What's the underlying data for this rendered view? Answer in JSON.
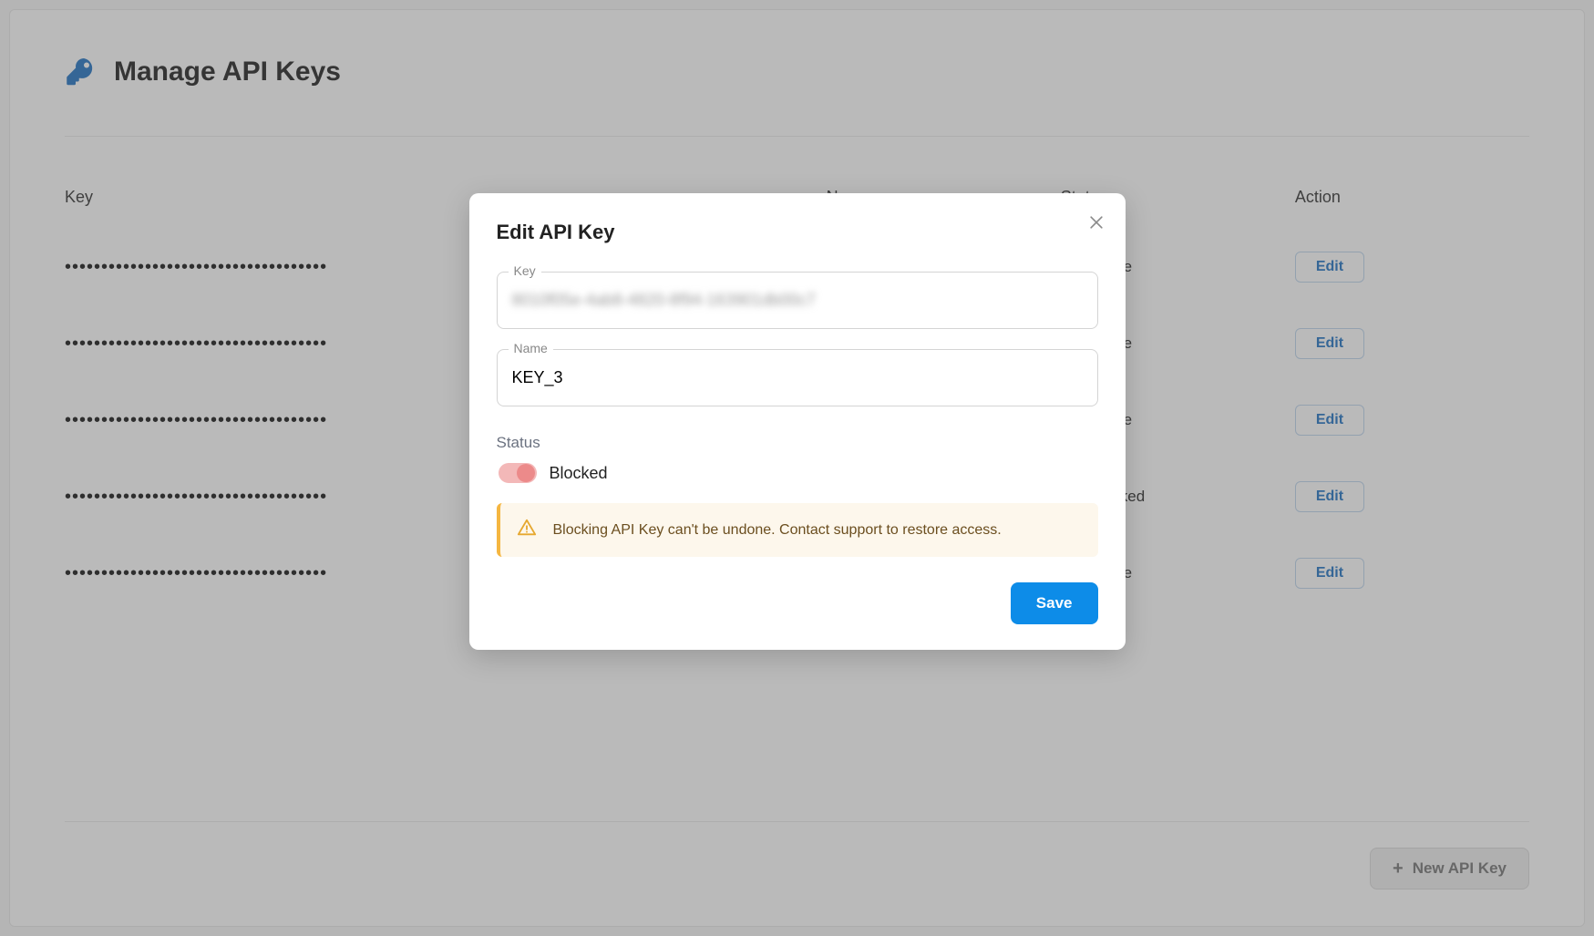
{
  "page": {
    "title": "Manage API Keys"
  },
  "table": {
    "columns": {
      "key": "Key",
      "name": "Name",
      "status": "Status",
      "action": "Action"
    },
    "rows": [
      {
        "masked": "••••••••••••••••••••••••••••••••••••",
        "name": "",
        "status": "Active",
        "status_kind": "active",
        "action": "Edit"
      },
      {
        "masked": "••••••••••••••••••••••••••••••••••••",
        "name": "",
        "status": "Active",
        "status_kind": "active",
        "action": "Edit"
      },
      {
        "masked": "••••••••••••••••••••••••••••••••••••",
        "name": "",
        "status": "Active",
        "status_kind": "active",
        "action": "Edit"
      },
      {
        "masked": "••••••••••••••••••••••••••••••••••••",
        "name": "",
        "status": "Blocked",
        "status_kind": "blocked",
        "action": "Edit"
      },
      {
        "masked": "••••••••••••••••••••••••••••••••••••",
        "name": "",
        "status": "Active",
        "status_kind": "active",
        "action": "Edit"
      }
    ]
  },
  "footer": {
    "new_key_label": "New API Key"
  },
  "modal": {
    "title": "Edit API Key",
    "key_label": "Key",
    "key_value": "8010f05e-4ab8-4820-8f94-163901db00c7",
    "name_label": "Name",
    "name_value": "KEY_3",
    "status_section_label": "Status",
    "toggle_label": "Blocked",
    "warning_text": "Blocking API Key can't be undone. Contact support to restore access.",
    "save_label": "Save"
  }
}
